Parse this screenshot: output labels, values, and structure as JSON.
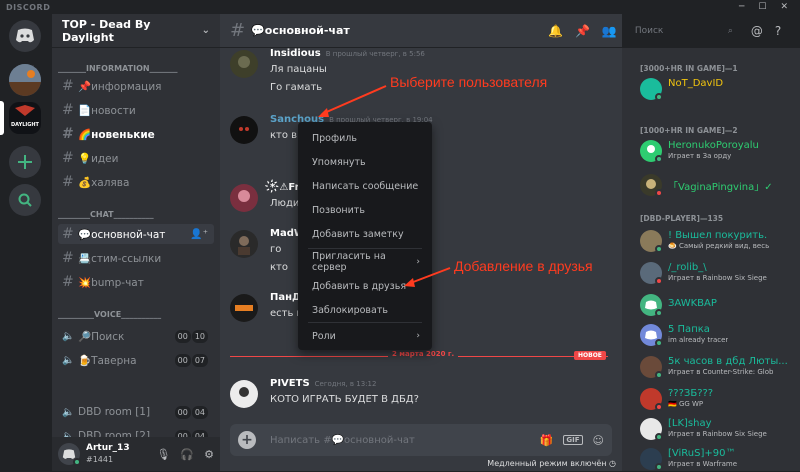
{
  "app": {
    "brand": "DISCORD"
  },
  "window": {
    "minimize": "─",
    "maximize": "☐",
    "close": "✕"
  },
  "server": {
    "name": "TOP - Dead By Daylight"
  },
  "categories": {
    "info": "_______INFORMATION_______",
    "chat": "________CHAT__________",
    "voice": "_________VOICE__________"
  },
  "channels": [
    {
      "label": "📌информация"
    },
    {
      "label": "📄новости"
    },
    {
      "label": "🌈новенькие"
    },
    {
      "label": "💡идеи"
    },
    {
      "label": "💰халява"
    },
    {
      "label": "💬основной-чат"
    },
    {
      "label": "📇стим-ссылки"
    },
    {
      "label": "💥bump-чат"
    }
  ],
  "voice_channels": [
    {
      "label": "🔎Поиск",
      "a": "00",
      "b": "10"
    },
    {
      "label": "🍺Таверна",
      "a": "00",
      "b": "07"
    },
    {
      "label": "DBD room [1]",
      "a": "00",
      "b": "04"
    },
    {
      "label": "DBD room [2]",
      "a": "00",
      "b": "04"
    }
  ],
  "user": {
    "name": "Artur_13",
    "tag": "#1441"
  },
  "channel_header": {
    "name": "💬основной-чат"
  },
  "search": {
    "placeholder": "Поиск"
  },
  "messages": [
    {
      "author": "Insidious",
      "time": "В прошлый четверг, в 5:56",
      "lines": [
        "Ля пацаны",
        "Го гамать"
      ]
    },
    {
      "author": "Sanchous",
      "time": "В прошлый четверг, в 19:04",
      "lines": [
        "кто в д"
      ]
    },
    {
      "author": "*҉⚠Fr",
      "time": "",
      "lines": [
        "Люди"
      ]
    },
    {
      "author": "MadW",
      "time": "",
      "lines": [
        "го",
        "кто"
      ]
    },
    {
      "author": "ПанДо",
      "time": "",
      "lines": [
        "есть кт"
      ]
    },
    {
      "author": "PIVETS",
      "time": "Сегодня, в 13:12",
      "lines": [
        "КОТО ИГРАТЬ БУДЕТ  В ДБД?"
      ]
    }
  ],
  "divider": {
    "date": "2 марта 2020 г.",
    "badge": "НОВОЕ"
  },
  "composer": {
    "placeholder": "Написать #💬основной-чат"
  },
  "slowmode": "Медленный режим включён",
  "context_menu": [
    "Профиль",
    "Упомянуть",
    "Написать сообщение",
    "Позвонить",
    "Добавить заметку",
    "Пригласить на сервер",
    "Добавить в друзья",
    "Заблокировать",
    "Роли"
  ],
  "annotations": {
    "select_user": "Выберите пользователя",
    "add_friend": "Добавление в друзья"
  },
  "member_groups": [
    {
      "title": "[3000+HR IN GAME]—1"
    },
    {
      "title": "[1000+HR IN GAME]—2"
    },
    {
      "title": "[DBD-PLAYER]—135"
    }
  ],
  "members": [
    {
      "name": "NoT_DavID",
      "activity": "",
      "color": "#f1c40f",
      "status": "#43b581"
    },
    {
      "name": "HeronukoPoroyalu",
      "activity": "Играет в За орду",
      "color": "#2ecc71",
      "status": "#43b581"
    },
    {
      "name": "「VaginaPingvina」✓",
      "activity": "",
      "color": "#2ecc71",
      "status": "#f04747"
    },
    {
      "name": "! Вышел покурить.",
      "activity": "🍮 Самый редкий вид, весь",
      "color": "#1abc9c",
      "status": "#43b581"
    },
    {
      "name": "/_rolib_\\",
      "activity": "Играет в Rainbow Six Siege",
      "color": "#1abc9c",
      "status": "#f04747"
    },
    {
      "name": "ЗAWKBAP",
      "activity": "",
      "color": "#1abc9c",
      "status": "#43b581"
    },
    {
      "name": "5 Папка",
      "activity": "im already tracer",
      "color": "#1abc9c",
      "status": "#43b581"
    },
    {
      "name": "5к часов в дбд Люты...",
      "activity": "Играет в Counter-Strike: Glob",
      "color": "#1abc9c",
      "status": "#43b581"
    },
    {
      "name": "???ЗБ???",
      "activity": "🇩🇪 GG WP",
      "color": "#1abc9c",
      "status": "#f04747"
    },
    {
      "name": "[LK]shay",
      "activity": "Играет в Rainbow Six Siege",
      "color": "#1abc9c",
      "status": "#43b581"
    },
    {
      "name": "[ViRuS]+90™",
      "activity": "Играет в Warframe",
      "color": "#1abc9c",
      "status": "#43b581"
    }
  ]
}
